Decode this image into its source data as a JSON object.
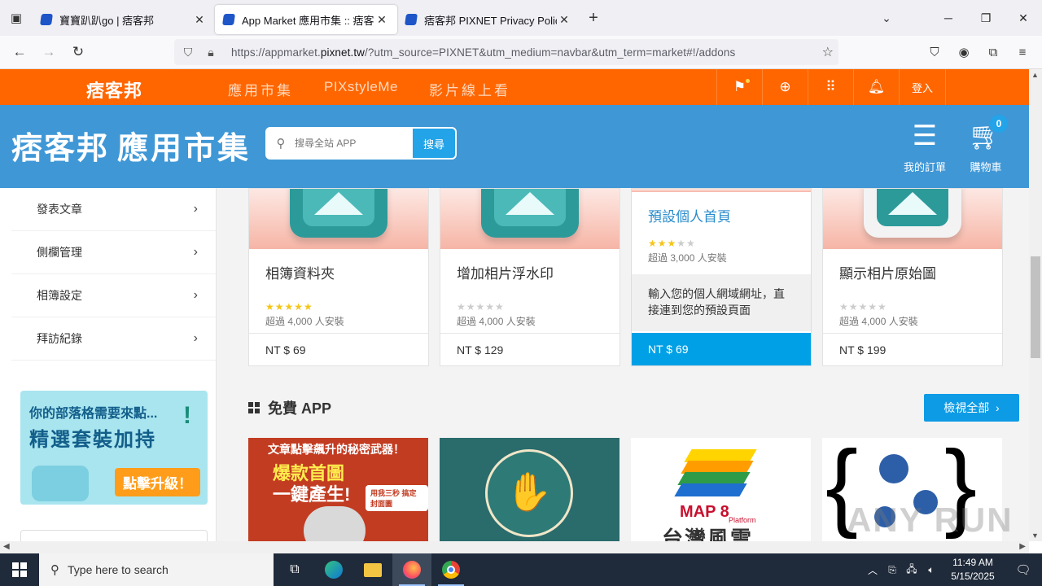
{
  "browser": {
    "tabs": [
      {
        "title": "寶寶趴趴go | 痞客邦",
        "active": false
      },
      {
        "title": "App Market 應用市集 :: 痞客邦",
        "active": true
      },
      {
        "title": "痞客邦 PIXNET Privacy Policy",
        "active": false
      }
    ],
    "url_prefix": "https://appmarket.",
    "url_domain": "pixnet.tw",
    "url_suffix": "/?utm_source=PIXNET&utm_medium=navbar&utm_term=market#!/addons"
  },
  "site_nav": {
    "logo": "痞客邦",
    "links": [
      "應用市集",
      "PIXstyleMe",
      "影片線上看"
    ],
    "login": "登入"
  },
  "header": {
    "brand": "痞客邦",
    "brand_sub": "應用市集",
    "search_placeholder": "搜尋全站 APP",
    "search_button": "搜尋",
    "orders_label": "我的訂單",
    "cart_label": "購物車",
    "cart_count": "0"
  },
  "sidebar": {
    "items": [
      "發表文章",
      "側欄管理",
      "相簿設定",
      "拜訪紀錄"
    ],
    "promo": {
      "line1": "你的部落格需要來點...",
      "line2": "精選套裝加持",
      "button": "點擊升級！"
    }
  },
  "paid_apps": [
    {
      "name": "相簿資料夾",
      "stars": 5,
      "installs": "超過 4,000 人安裝",
      "price": "NT $ 69"
    },
    {
      "name": "增加相片浮水印",
      "stars": 0,
      "installs": "超過 4,000 人安裝",
      "price": "NT $ 129"
    },
    {
      "name": "預設個人首頁",
      "stars": 3,
      "installs": "超過 3,000 人安裝",
      "desc": "輸入您的個人網域網址，直接連到您的預設頁面",
      "price": "NT $ 69"
    },
    {
      "name": "顯示相片原始圖",
      "stars": 0,
      "installs": "超過 4,000 人安裝",
      "price": "NT $ 199"
    }
  ],
  "free_section": {
    "title": "免費 APP",
    "view_all": "檢視全部",
    "card1": {
      "line1": "文章點擊飆升的秘密武器！",
      "line2": "爆款首圖",
      "line3": "一鍵產生!",
      "tag": "用我三秒 搞定封面圖"
    },
    "card3": {
      "brand": "MAP 8",
      "platform": "Platform",
      "text": "台灣風雲"
    }
  },
  "watermark": "ANY RUN",
  "taskbar": {
    "search_placeholder": "Type here to search",
    "time": "11:49 AM",
    "date": "5/15/2025"
  },
  "colors": {
    "orange": "#ff6600",
    "blue_header": "#3f97d6",
    "accent_blue": "#00a0e6",
    "star": "#f5c518"
  },
  "icons": [
    "tab-list-icon",
    "back-icon",
    "forward-icon",
    "reload-icon",
    "shield-icon",
    "lock-icon",
    "bookmark-star-icon",
    "pocket-icon",
    "account-icon",
    "extensions-icon",
    "menu-icon",
    "bookmark-icon",
    "search-circle-icon",
    "grid-icon",
    "bell-icon",
    "orders-icon",
    "cart-icon",
    "chevron-right-icon"
  ]
}
